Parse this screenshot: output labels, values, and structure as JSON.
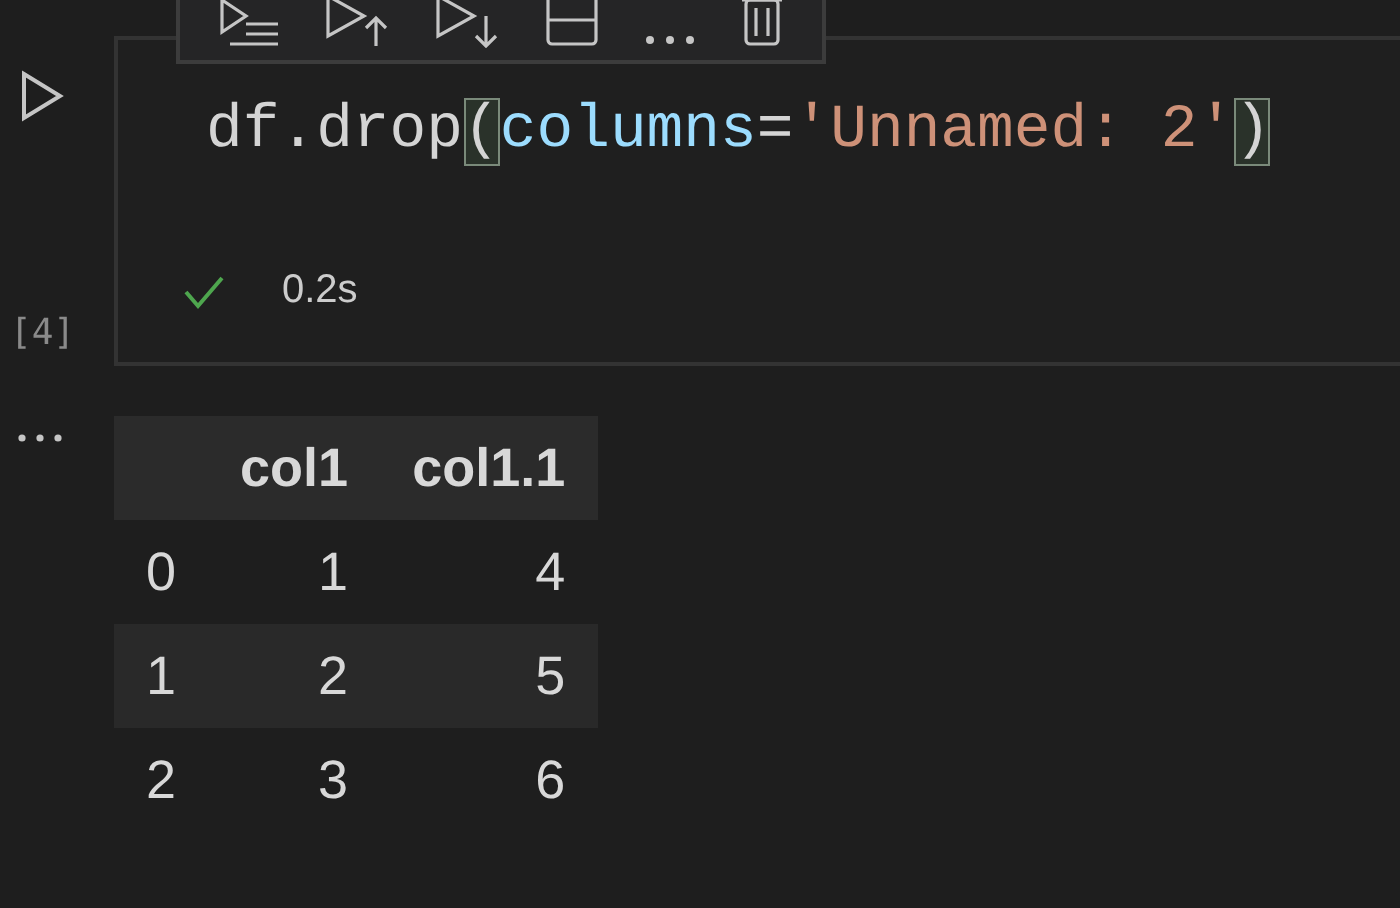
{
  "cell": {
    "execution_count": "[4]",
    "code": [
      {
        "kind": "plain",
        "text": "df.drop"
      },
      {
        "kind": "bracket",
        "text": "("
      },
      {
        "kind": "param",
        "text": "columns"
      },
      {
        "kind": "plain",
        "text": "="
      },
      {
        "kind": "string",
        "text": "'Unnamed: 2'"
      },
      {
        "kind": "bracket",
        "text": ")"
      }
    ],
    "status": {
      "success": true,
      "duration": "0.2s"
    }
  },
  "output": {
    "table": {
      "columns": [
        "col1",
        "col1.1"
      ],
      "rows": [
        {
          "index": "0",
          "values": [
            "1",
            "4"
          ]
        },
        {
          "index": "1",
          "values": [
            "2",
            "5"
          ]
        },
        {
          "index": "2",
          "values": [
            "3",
            "6"
          ]
        }
      ]
    }
  }
}
